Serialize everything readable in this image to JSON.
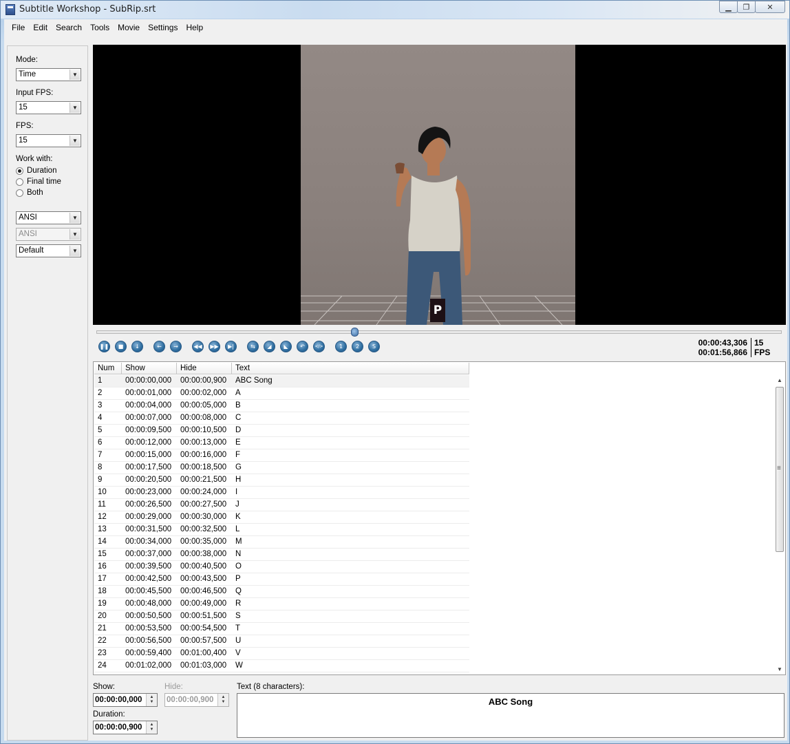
{
  "window": {
    "title": "Subtitle Workshop - SubRip.srt",
    "minimize_glyph": "▁",
    "maximize_glyph": "❐",
    "close_glyph": "✕"
  },
  "menu": [
    "File",
    "Edit",
    "Search",
    "Tools",
    "Movie",
    "Settings",
    "Help"
  ],
  "left_panel": {
    "mode_label": "Mode:",
    "mode_value": "Time",
    "input_fps_label": "Input FPS:",
    "input_fps_value": "15",
    "fps_label": "FPS:",
    "fps_value": "15",
    "work_with_label": "Work with:",
    "work_with_options": [
      "Duration",
      "Final time",
      "Both"
    ],
    "work_with_selected": "Duration",
    "charset1": "ANSI",
    "charset2": "ANSI",
    "style": "Default",
    "arrow_glyph": "▼"
  },
  "video": {
    "subtitle_text": "P",
    "seek_position": 0.375
  },
  "player_buttons": [
    "pause-icon",
    "stop-icon",
    "down-icon",
    "prev-icon",
    "next-icon",
    "rewind-icon",
    "fast-forward-icon",
    "step-icon",
    "sync-icon",
    "mark-start-icon",
    "mark-end-icon",
    "back-icon",
    "code-icon",
    "one-icon",
    "two-icon",
    "s-icon"
  ],
  "player_glyphs": [
    "❚❚",
    "■",
    "↓",
    "←",
    "→",
    "◀◀",
    "▶▶",
    "▶|",
    "⇆",
    "◢",
    "◣",
    "↶",
    "</>",
    "1",
    "2",
    "S"
  ],
  "time": {
    "current": "00:00:43,306",
    "total": "00:01:56,866",
    "fps_value": "15",
    "fps_label": "FPS"
  },
  "list": {
    "headers": [
      "Num",
      "Show",
      "Hide",
      "Text"
    ],
    "rows": [
      [
        "1",
        "00:00:00,000",
        "00:00:00,900",
        "ABC Song"
      ],
      [
        "2",
        "00:00:01,000",
        "00:00:02,000",
        "A"
      ],
      [
        "3",
        "00:00:04,000",
        "00:00:05,000",
        "B"
      ],
      [
        "4",
        "00:00:07,000",
        "00:00:08,000",
        "C"
      ],
      [
        "5",
        "00:00:09,500",
        "00:00:10,500",
        "D"
      ],
      [
        "6",
        "00:00:12,000",
        "00:00:13,000",
        "E"
      ],
      [
        "7",
        "00:00:15,000",
        "00:00:16,000",
        "F"
      ],
      [
        "8",
        "00:00:17,500",
        "00:00:18,500",
        "G"
      ],
      [
        "9",
        "00:00:20,500",
        "00:00:21,500",
        "H"
      ],
      [
        "10",
        "00:00:23,000",
        "00:00:24,000",
        "I"
      ],
      [
        "11",
        "00:00:26,500",
        "00:00:27,500",
        "J"
      ],
      [
        "12",
        "00:00:29,000",
        "00:00:30,000",
        "K"
      ],
      [
        "13",
        "00:00:31,500",
        "00:00:32,500",
        "L"
      ],
      [
        "14",
        "00:00:34,000",
        "00:00:35,000",
        "M"
      ],
      [
        "15",
        "00:00:37,000",
        "00:00:38,000",
        "N"
      ],
      [
        "16",
        "00:00:39,500",
        "00:00:40,500",
        "O"
      ],
      [
        "17",
        "00:00:42,500",
        "00:00:43,500",
        "P"
      ],
      [
        "18",
        "00:00:45,500",
        "00:00:46,500",
        "Q"
      ],
      [
        "19",
        "00:00:48,000",
        "00:00:49,000",
        "R"
      ],
      [
        "20",
        "00:00:50,500",
        "00:00:51,500",
        "S"
      ],
      [
        "21",
        "00:00:53,500",
        "00:00:54,500",
        "T"
      ],
      [
        "22",
        "00:00:56,500",
        "00:00:57,500",
        "U"
      ],
      [
        "23",
        "00:00:59,400",
        "00:01:00,400",
        "V"
      ],
      [
        "24",
        "00:01:02,000",
        "00:01:03,000",
        "W"
      ]
    ],
    "scroll_up_glyph": "▲",
    "scroll_down_glyph": "▼"
  },
  "editor": {
    "show_label": "Show:",
    "show_value": "00:00:00,000",
    "hide_label": "Hide:",
    "hide_value": "00:00:00,900",
    "duration_label": "Duration:",
    "duration_value": "00:00:00,900",
    "text_label": "Text (8 characters):",
    "text_value": "ABC Song",
    "spin_up": "▲",
    "spin_down": "▼"
  }
}
